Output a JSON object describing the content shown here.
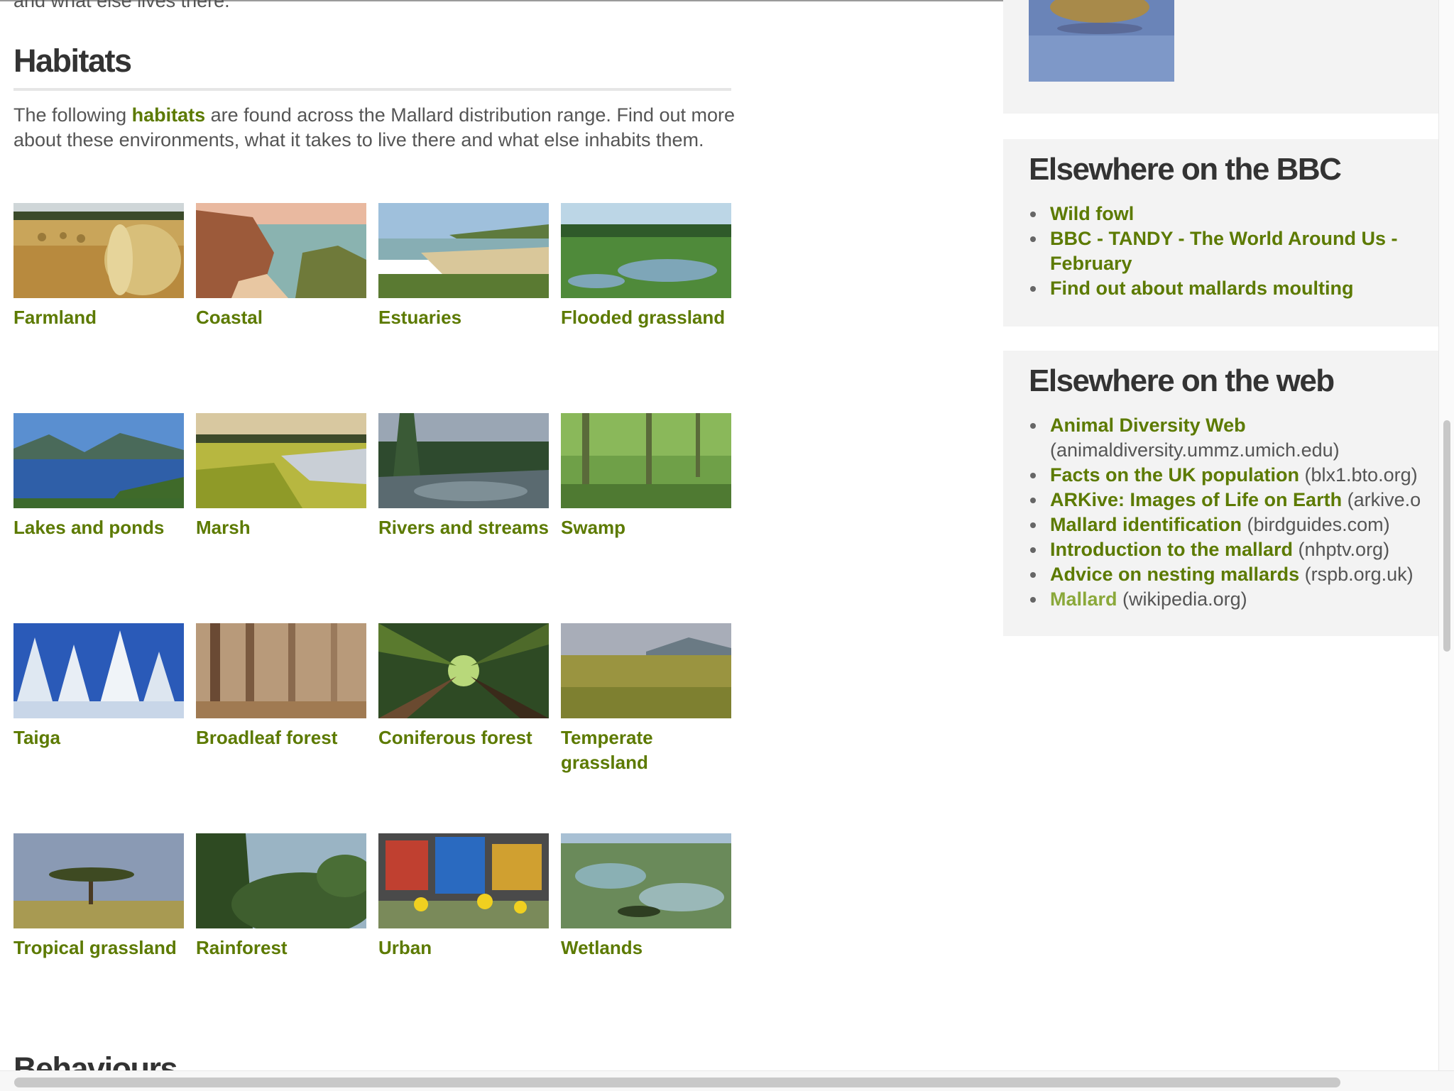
{
  "main": {
    "clipped_text": "and what else lives there.",
    "section_title": "Habitats",
    "intro_before": "The following ",
    "intro_link": "habitats",
    "intro_after": " are found across the Mallard distribution range. Find out more about these environments, what it takes to live there and what else inhabits them.",
    "habitats": [
      {
        "label": "Farmland",
        "image": "farmland-hay-bales"
      },
      {
        "label": "Coastal",
        "image": "coastal-cliffs"
      },
      {
        "label": "Estuaries",
        "image": "estuary-beach"
      },
      {
        "label": "Flooded grassland",
        "image": "flooded-grassland"
      },
      {
        "label": "Lakes and ponds",
        "image": "mountain-lake"
      },
      {
        "label": "Marsh",
        "image": "marsh-grass"
      },
      {
        "label": "Rivers and streams",
        "image": "river-forest"
      },
      {
        "label": "Swamp",
        "image": "green-swamp"
      },
      {
        "label": "Taiga",
        "image": "snowy-taiga"
      },
      {
        "label": "Broadleaf forest",
        "image": "misty-broadleaf-forest"
      },
      {
        "label": "Coniferous forest",
        "image": "conifer-canopy"
      },
      {
        "label": "Temperate grassland",
        "image": "temperate-grassland"
      },
      {
        "label": "Tropical grassland",
        "image": "acacia-savanna"
      },
      {
        "label": "Rainforest",
        "image": "rainforest"
      },
      {
        "label": "Urban",
        "image": "graffiti-flowers"
      },
      {
        "label": "Wetlands",
        "image": "aerial-wetlands"
      }
    ],
    "next_heading": "Behaviours"
  },
  "sidebar": {
    "bbc": {
      "title": "Elsewhere on the BBC",
      "links": [
        {
          "text": "Wild fowl"
        },
        {
          "text": "BBC - TANDY - The World Around Us - February"
        },
        {
          "text": "Find out about mallards moulting"
        }
      ]
    },
    "web": {
      "title": "Elsewhere on the web",
      "links": [
        {
          "text": "Animal Diversity Web",
          "domain": "(animaldiversity.ummz.umich.edu)"
        },
        {
          "text": "Facts on the UK population",
          "domain": "(blx1.bto.org)"
        },
        {
          "text": "ARKive: Images of Life on Earth",
          "domain": "(arkive.o"
        },
        {
          "text": "Mallard identification",
          "domain": "(birdguides.com)"
        },
        {
          "text": "Introduction to the mallard",
          "domain": "(nhptv.org)"
        },
        {
          "text": "Advice on nesting mallards",
          "domain": "(rspb.org.uk)"
        },
        {
          "text": "Mallard",
          "domain": "(wikipedia.org)"
        }
      ]
    }
  },
  "colors": {
    "link": "#5c7a00",
    "visited_link": "#8aa83a",
    "heading": "#333333",
    "sidebar_bg": "#f3f3f3"
  }
}
